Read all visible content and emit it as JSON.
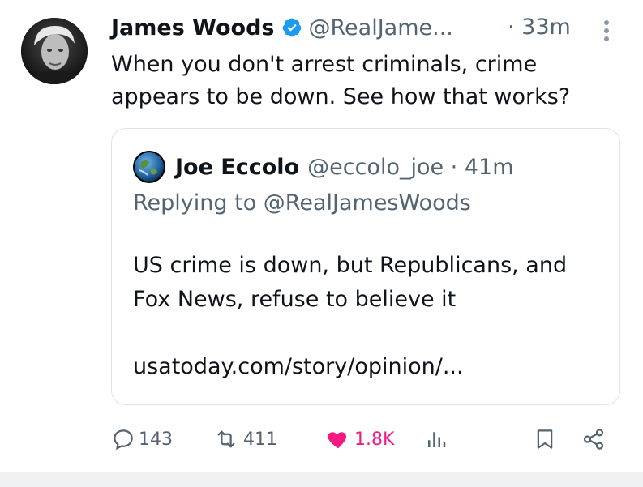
{
  "tweet": {
    "author_name": "James Woods",
    "author_handle": "@RealJame...",
    "time": "· 33m",
    "text": "When you don't arrest criminals, crime appears to be down. See how that works?"
  },
  "quote": {
    "author_name": "Joe Eccolo",
    "author_handle": "@eccolo_joe · 41m",
    "replying_to": "Replying to @RealJamesWoods",
    "text": "US crime is down, but Republicans, and Fox News, refuse to believe it",
    "link": "usatoday.com/story/opinion/..."
  },
  "actions": {
    "replies": "143",
    "retweets": "411",
    "likes": "1.8K"
  },
  "colors": {
    "verified": "#1d9bf0",
    "like": "#f91880",
    "muted": "#536471"
  },
  "icons": [
    "verified-badge-icon",
    "more-options-icon",
    "reply-icon",
    "retweet-icon",
    "heart-icon",
    "views-icon",
    "bookmark-icon",
    "share-icon"
  ]
}
